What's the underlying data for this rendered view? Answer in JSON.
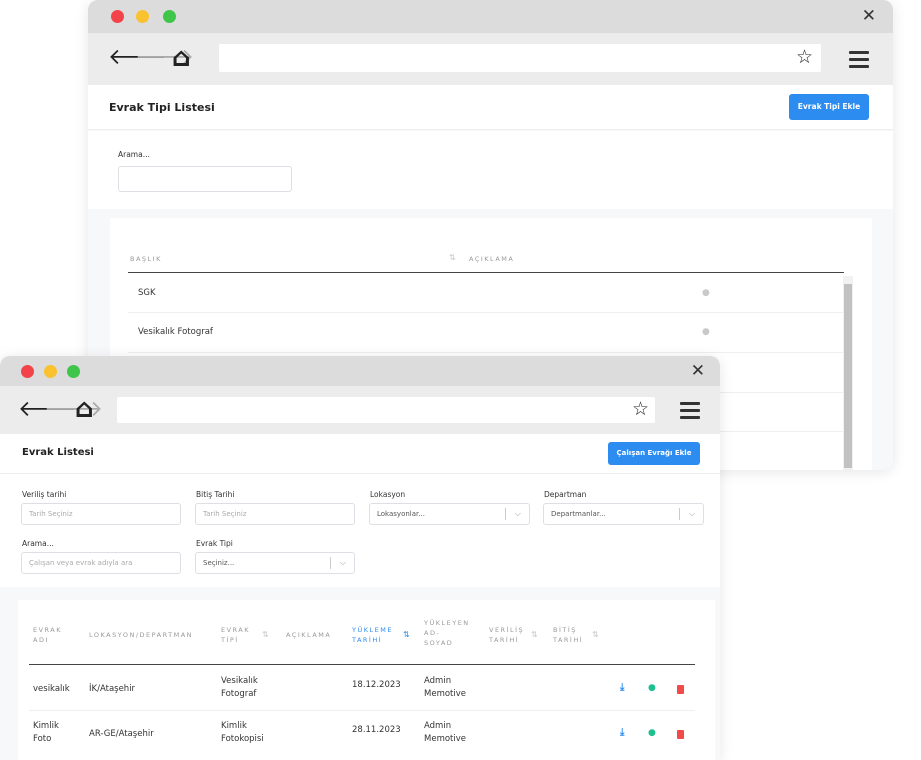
{
  "back_window": {
    "controls": {
      "close": "✕"
    },
    "toolbar": {
      "back": "🡐",
      "forward": "🡒",
      "home": "⌂",
      "star": "☆"
    },
    "page_title": "Evrak Tipi Listesi",
    "add_button": "Evrak Tipi Ekle",
    "search": {
      "label": "Arama..."
    },
    "table": {
      "headers": [
        "BAŞLIK",
        "AÇIKLAMA"
      ],
      "rows": [
        {
          "title": "SGK"
        },
        {
          "title": "Vesikalık Fotograf"
        }
      ]
    }
  },
  "front_window": {
    "controls": {
      "close": "✕"
    },
    "toolbar": {
      "back": "🡐",
      "forward": "🡒",
      "home": "⌂",
      "star": "☆"
    },
    "page_title": "Evrak Listesi",
    "add_button": "Çalışan Evrağı Ekle",
    "filters": {
      "issue_date": {
        "label": "Veriliş tarihi",
        "placeholder": "Tarih Seçiniz"
      },
      "end_date": {
        "label": "Bitiş Tarihi",
        "placeholder": "Tarih Seçiniz"
      },
      "location": {
        "label": "Lokasyon",
        "placeholder": "Lokasyonlar..."
      },
      "department": {
        "label": "Departman",
        "placeholder": "Departmanlar..."
      },
      "search": {
        "label": "Arama...",
        "placeholder": "Çalışan veya evrak adıyla ara"
      },
      "doc_type": {
        "label": "Evrak Tipi",
        "placeholder": "Seçiniz..."
      }
    },
    "table": {
      "headers": {
        "doc_name": [
          "EVRAK",
          "ADI"
        ],
        "location_dept": [
          "LOKASYON/DEPARTMAN"
        ],
        "doc_type": [
          "EVRAK",
          "TİPİ"
        ],
        "description": [
          "AÇIKLAMA"
        ],
        "upload_date": [
          "YÜKLEME",
          "TARİHİ"
        ],
        "uploader": [
          "YÜKLEYEN",
          "AD-",
          "SOYAD"
        ],
        "issue_date": [
          "VERİLİŞ",
          "TARİHİ"
        ],
        "end_date": [
          "BİTİŞ",
          "TARİHİ"
        ]
      },
      "rows": [
        {
          "doc_name": [
            "vesikalık"
          ],
          "location": "İK/Ataşehir",
          "doc_type": [
            "Vesikalık",
            "Fotograf"
          ],
          "upload_date": "18.12.2023",
          "uploader": [
            "Admin",
            "Memotive"
          ]
        },
        {
          "doc_name": [
            "Kimlik",
            "Foto"
          ],
          "location": "AR-GE/Ataşehir",
          "doc_type": [
            "Kimlik",
            "Fotokopisi"
          ],
          "upload_date": "28.11.2023",
          "uploader": [
            "Admin",
            "Memotive"
          ]
        }
      ]
    },
    "action_colors": {
      "download": "#2d8cf0",
      "toggle": "#1fbf8f",
      "delete": "#f04a4a"
    }
  }
}
